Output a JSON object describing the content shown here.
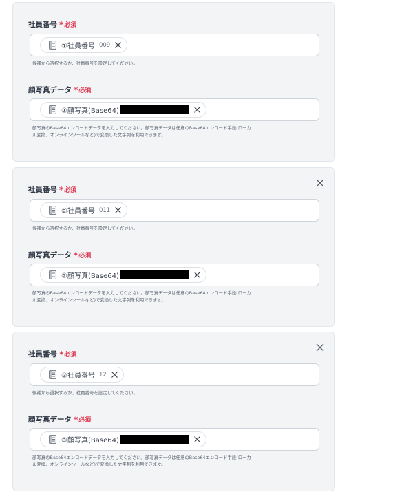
{
  "records": [
    {
      "employee_label": "社員番号",
      "employee_chip": "①社員番号",
      "employee_value": "009",
      "photo_label": "顔写真データ",
      "photo_chip": "①顔写真(Base64)"
    },
    {
      "employee_label": "社員番号",
      "employee_chip": "②社員番号",
      "employee_value": "011",
      "photo_label": "顔写真データ",
      "photo_chip": "②顔写真(Base64)"
    },
    {
      "employee_label": "社員番号",
      "employee_chip": "③社員番号",
      "employee_value": "12",
      "photo_label": "顔写真データ",
      "photo_chip": "③顔写真(Base64)"
    }
  ],
  "common": {
    "required_star": "*",
    "required_text": "必須",
    "employee_help": "候補から選択するか、社員番号を設定してください。",
    "photo_help_line1": "顔写真のBase64エンコードデータを入力してください。顔写真データは任意のBase64エンコード手段(ローカ",
    "photo_help_line2": "ル変換、オンラインツールなど)で変換した文字列を利用できます。"
  },
  "icons": {
    "chip_icon": "document-icon",
    "remove_chip": "close-icon",
    "remove_record": "close-icon"
  },
  "colors": {
    "required": "#e0364f",
    "card_bg": "#f3f4f6",
    "field_border": "#cfd4da"
  }
}
